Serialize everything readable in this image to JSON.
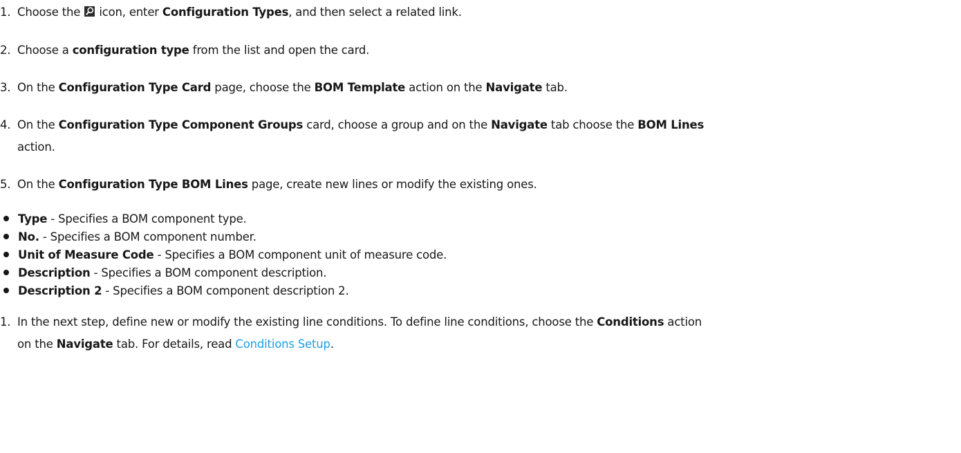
{
  "steps": [
    {
      "num": "1.",
      "pre": "Choose the ",
      "icon": "search-icon",
      "mid": " icon, enter ",
      "bold": "Configuration Types",
      "post": ", and then select a related link."
    },
    {
      "num": "2.",
      "pre": "Choose a ",
      "bold": "configuration type",
      "post": " from the list and open the card."
    },
    {
      "num": "3.",
      "t1": "On the ",
      "b1": "Configuration Type Card",
      "t2": " page, choose the ",
      "b2": "BOM Template",
      "t3": " action on the ",
      "b3": "Navigate",
      "t4": " tab."
    },
    {
      "num": "4.",
      "t1": "On the ",
      "b1": "Configuration Type Component Groups",
      "t2": " card, choose a group and on the ",
      "b2": "Navigate",
      "t3": " tab choose the ",
      "b3": "BOM Lines",
      "t4": "action."
    },
    {
      "num": "5.",
      "t1": "On the ",
      "b1": "Configuration Type BOM Lines",
      "t2": " page, create new lines or modify the existing ones."
    }
  ],
  "fields": [
    {
      "name": "Type",
      "desc": " - Specifies a BOM component type."
    },
    {
      "name": "No.",
      "desc": " - Specifies a BOM component number."
    },
    {
      "name": "Unit of Measure Code",
      "desc": " - Specifies a BOM component unit of measure code."
    },
    {
      "name": "Description",
      "desc": " - Specifies a BOM component description."
    },
    {
      "name": "Description 2",
      "desc": " - Specifies a BOM component description 2."
    }
  ],
  "final_step": {
    "num": "1.",
    "t1": "In the next step, define new or modify the existing line conditions. To define line conditions, choose the ",
    "b1": "Conditions",
    "t2": " action",
    "t3": "on the ",
    "b2": "Navigate",
    "t4": " tab. For details, read ",
    "link": "Conditions Setup",
    "t5": "."
  },
  "colors": {
    "text": "#171717",
    "link": "#1b9ee6"
  }
}
